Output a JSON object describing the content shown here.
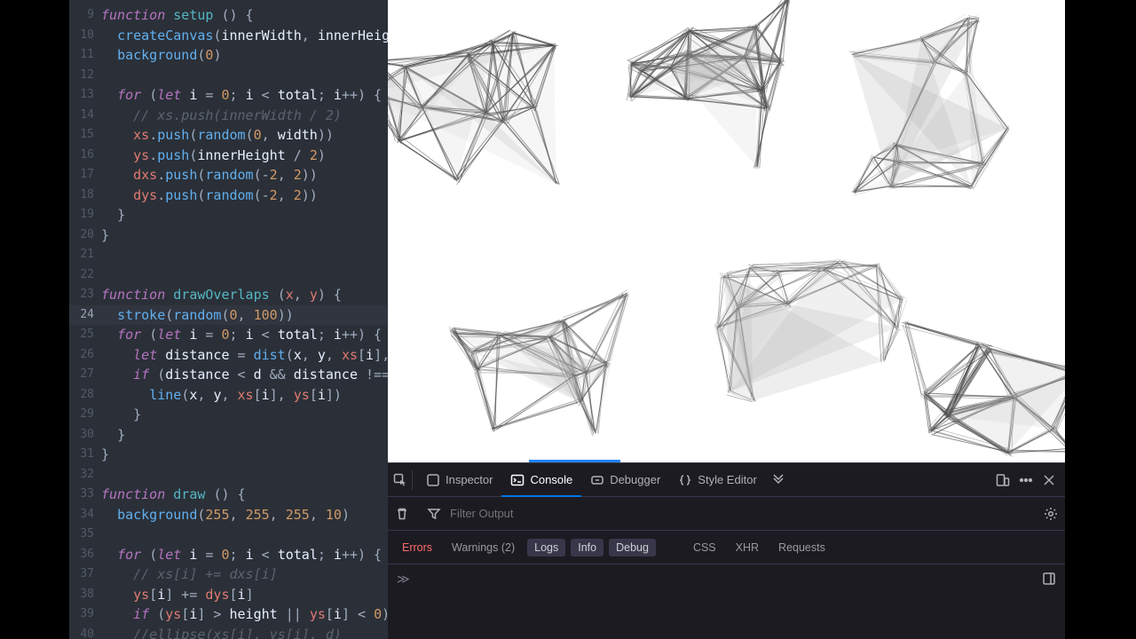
{
  "editor": {
    "first_line_number": 9,
    "highlighted_line": 24,
    "lines": [
      {
        "n": 9,
        "html": "<span class='tok-kw'>function</span> <span class='tok-fn'>setup</span> <span class='tok-pun'>() {</span>"
      },
      {
        "n": 10,
        "html": "  <span class='tok-call'>createCanvas</span><span class='tok-pun'>(</span><span class='tok-def'>innerWidth</span><span class='tok-pun'>,</span> <span class='tok-def'>innerHeig</span>"
      },
      {
        "n": 11,
        "html": "  <span class='tok-call'>background</span><span class='tok-pun'>(</span><span class='tok-num'>0</span><span class='tok-pun'>)</span>"
      },
      {
        "n": 12,
        "html": ""
      },
      {
        "n": 13,
        "html": "  <span class='tok-kw'>for</span> <span class='tok-pun'>(</span><span class='tok-kw'>let</span> <span class='tok-def'>i</span> <span class='tok-pun'>=</span> <span class='tok-num'>0</span><span class='tok-pun'>;</span> <span class='tok-def'>i</span> <span class='tok-pun'>&lt;</span> <span class='tok-def'>total</span><span class='tok-pun'>;</span> <span class='tok-def'>i</span><span class='tok-pun'>++) {</span>"
      },
      {
        "n": 14,
        "html": "    <span class='tok-cmt'>// xs.push(innerWidth / 2)</span>"
      },
      {
        "n": 15,
        "html": "    <span class='tok-var'>xs</span><span class='tok-pun'>.</span><span class='tok-call'>push</span><span class='tok-pun'>(</span><span class='tok-call'>random</span><span class='tok-pun'>(</span><span class='tok-num'>0</span><span class='tok-pun'>,</span> <span class='tok-def'>width</span><span class='tok-pun'>))</span>"
      },
      {
        "n": 16,
        "html": "    <span class='tok-var'>ys</span><span class='tok-pun'>.</span><span class='tok-call'>push</span><span class='tok-pun'>(</span><span class='tok-def'>innerHeight</span> <span class='tok-pun'>/</span> <span class='tok-num'>2</span><span class='tok-pun'>)</span>"
      },
      {
        "n": 17,
        "html": "    <span class='tok-var'>dxs</span><span class='tok-pun'>.</span><span class='tok-call'>push</span><span class='tok-pun'>(</span><span class='tok-call'>random</span><span class='tok-pun'>(</span><span class='tok-pun'>-</span><span class='tok-num'>2</span><span class='tok-pun'>,</span> <span class='tok-num'>2</span><span class='tok-pun'>))</span>"
      },
      {
        "n": 18,
        "html": "    <span class='tok-var'>dys</span><span class='tok-pun'>.</span><span class='tok-call'>push</span><span class='tok-pun'>(</span><span class='tok-call'>random</span><span class='tok-pun'>(</span><span class='tok-pun'>-</span><span class='tok-num'>2</span><span class='tok-pun'>,</span> <span class='tok-num'>2</span><span class='tok-pun'>))</span>"
      },
      {
        "n": 19,
        "html": "  <span class='tok-pun'>}</span>"
      },
      {
        "n": 20,
        "html": "<span class='tok-pun'>}</span>"
      },
      {
        "n": 21,
        "html": ""
      },
      {
        "n": 22,
        "html": ""
      },
      {
        "n": 23,
        "html": "<span class='tok-kw'>function</span> <span class='tok-fn'>drawOverlaps</span> <span class='tok-pun'>(</span><span class='tok-var'>x</span><span class='tok-pun'>,</span> <span class='tok-var'>y</span><span class='tok-pun'>) {</span>"
      },
      {
        "n": 24,
        "html": "  <span class='tok-call'>stroke</span><span class='tok-pun'>(</span><span class='tok-call'>random</span><span class='tok-pun'>(</span><span class='tok-num'>0</span><span class='tok-pun'>,</span> <span class='tok-num'>100</span><span class='tok-pun'>))</span>"
      },
      {
        "n": 25,
        "html": "  <span class='tok-kw'>for</span> <span class='tok-pun'>(</span><span class='tok-kw'>let</span> <span class='tok-def'>i</span> <span class='tok-pun'>=</span> <span class='tok-num'>0</span><span class='tok-pun'>;</span> <span class='tok-def'>i</span> <span class='tok-pun'>&lt;</span> <span class='tok-def'>total</span><span class='tok-pun'>;</span> <span class='tok-def'>i</span><span class='tok-pun'>++) {</span>"
      },
      {
        "n": 26,
        "html": "    <span class='tok-kw'>let</span> <span class='tok-def'>distance</span> <span class='tok-pun'>=</span> <span class='tok-call'>dist</span><span class='tok-pun'>(</span><span class='tok-def'>x</span><span class='tok-pun'>,</span> <span class='tok-def'>y</span><span class='tok-pun'>,</span> <span class='tok-var'>xs</span><span class='tok-pun'>[</span><span class='tok-def'>i</span><span class='tok-pun'>],</span>"
      },
      {
        "n": 27,
        "html": "    <span class='tok-kw'>if</span> <span class='tok-pun'>(</span><span class='tok-def'>distance</span> <span class='tok-pun'>&lt;</span> <span class='tok-def'>d</span> <span class='tok-pun'>&amp;&amp;</span> <span class='tok-def'>distance</span> <span class='tok-pun'>!==</span>"
      },
      {
        "n": 28,
        "html": "      <span class='tok-call'>line</span><span class='tok-pun'>(</span><span class='tok-def'>x</span><span class='tok-pun'>,</span> <span class='tok-def'>y</span><span class='tok-pun'>,</span> <span class='tok-var'>xs</span><span class='tok-pun'>[</span><span class='tok-def'>i</span><span class='tok-pun'>],</span> <span class='tok-var'>ys</span><span class='tok-pun'>[</span><span class='tok-def'>i</span><span class='tok-pun'>])</span>"
      },
      {
        "n": 29,
        "html": "    <span class='tok-pun'>}</span>"
      },
      {
        "n": 30,
        "html": "  <span class='tok-pun'>}</span>"
      },
      {
        "n": 31,
        "html": "<span class='tok-pun'>}</span>"
      },
      {
        "n": 32,
        "html": ""
      },
      {
        "n": 33,
        "html": "<span class='tok-kw'>function</span> <span class='tok-fn'>draw</span> <span class='tok-pun'>() {</span>"
      },
      {
        "n": 34,
        "html": "  <span class='tok-call'>background</span><span class='tok-pun'>(</span><span class='tok-num'>255</span><span class='tok-pun'>,</span> <span class='tok-num'>255</span><span class='tok-pun'>,</span> <span class='tok-num'>255</span><span class='tok-pun'>,</span> <span class='tok-num'>10</span><span class='tok-pun'>)</span>"
      },
      {
        "n": 35,
        "html": ""
      },
      {
        "n": 36,
        "html": "  <span class='tok-kw'>for</span> <span class='tok-pun'>(</span><span class='tok-kw'>let</span> <span class='tok-def'>i</span> <span class='tok-pun'>=</span> <span class='tok-num'>0</span><span class='tok-pun'>;</span> <span class='tok-def'>i</span> <span class='tok-pun'>&lt;</span> <span class='tok-def'>total</span><span class='tok-pun'>;</span> <span class='tok-def'>i</span><span class='tok-pun'>++) {</span>"
      },
      {
        "n": 37,
        "html": "    <span class='tok-cmt'>// xs[i] += dxs[i]</span>"
      },
      {
        "n": 38,
        "html": "    <span class='tok-var'>ys</span><span class='tok-pun'>[</span><span class='tok-def'>i</span><span class='tok-pun'>] +=</span> <span class='tok-var'>dys</span><span class='tok-pun'>[</span><span class='tok-def'>i</span><span class='tok-pun'>]</span>"
      },
      {
        "n": 39,
        "html": "    <span class='tok-kw'>if</span> <span class='tok-pun'>(</span><span class='tok-var'>ys</span><span class='tok-pun'>[</span><span class='tok-def'>i</span><span class='tok-pun'>] &gt;</span> <span class='tok-def'>height</span> <span class='tok-pun'>||</span> <span class='tok-var'>ys</span><span class='tok-pun'>[</span><span class='tok-def'>i</span><span class='tok-pun'>] &lt;</span> <span class='tok-num'>0</span><span class='tok-pun'>)</span>"
      },
      {
        "n": 40,
        "html": "    <span class='tok-cmt'>//ellipse(xs[i], ys[i], d)</span>"
      }
    ]
  },
  "devtools": {
    "tabs": {
      "inspector": "Inspector",
      "console": "Console",
      "debugger": "Debugger",
      "style_editor": "Style Editor"
    },
    "active_tab": "console",
    "filter_placeholder": "Filter Output",
    "categories": {
      "errors": "Errors",
      "warnings": "Warnings (2)",
      "logs": "Logs",
      "info": "Info",
      "debug": "Debug",
      "css": "CSS",
      "xhr": "XHR",
      "requests": "Requests"
    }
  },
  "canvas": {
    "clusters": 6,
    "nodes_per_cluster": 14,
    "connect_dist": 110,
    "seed": 9137
  }
}
